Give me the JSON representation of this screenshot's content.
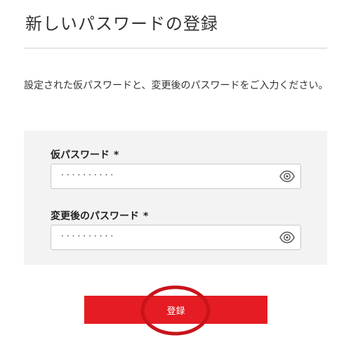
{
  "page": {
    "title": "新しいパスワードの登録",
    "description": "設定された仮パスワードと、変更後のパスワードをご入力ください。"
  },
  "form": {
    "temp_password": {
      "label": "仮パスワード",
      "required_mark": "*",
      "value": "··········",
      "toggle_icon": "eye-icon"
    },
    "new_password": {
      "label": "変更後のパスワード",
      "required_mark": "*",
      "value": "··········",
      "toggle_icon": "eye-icon"
    }
  },
  "actions": {
    "submit_label": "登録"
  },
  "colors": {
    "accent": "#e51c23",
    "panel_bg": "#f3f3f3",
    "highlight": "#c8141b"
  }
}
